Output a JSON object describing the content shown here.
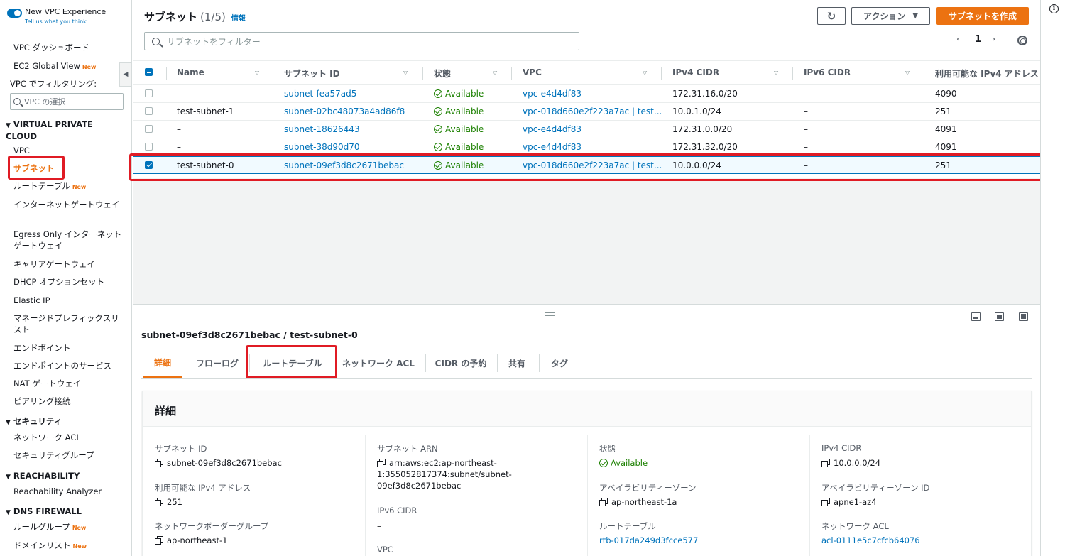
{
  "sidebar": {
    "new_vpc_experience": "New VPC Experience",
    "tell_us": "Tell us what you think",
    "dashboard": "VPC ダッシュボード",
    "ec2_global_view": "EC2 Global View",
    "new_badge": "New",
    "filter_label": "VPC でフィルタリング:",
    "filter_placeholder": "VPC の選択",
    "section_vpc": "VIRTUAL PRIVATE CLOUD",
    "vpc": "VPC",
    "subnets": "サブネット",
    "route_tables": "ルートテーブル",
    "igw": "インターネットゲートウェイ",
    "egress_only": "Egress Only インターネットゲートウェイ",
    "carrier_gw": "キャリアゲートウェイ",
    "dhcp": "DHCP オプションセット",
    "elastic_ip": "Elastic IP",
    "managed_prefix": "マネージドプレフィックスリスト",
    "endpoints": "エンドポイント",
    "endpoint_services": "エンドポイントのサービス",
    "nat_gw": "NAT ゲートウェイ",
    "peering": "ピアリング接続",
    "section_security": "セキュリティ",
    "network_acl": "ネットワーク ACL",
    "security_group": "セキュリティグループ",
    "section_reachability": "REACHABILITY",
    "reachability_analyzer": "Reachability Analyzer",
    "section_dns_firewall": "DNS FIREWALL",
    "rule_groups": "ルールグループ",
    "domain_lists": "ドメインリスト"
  },
  "header": {
    "title": "サブネット",
    "count": "(1/5)",
    "info": "情報",
    "refresh_icon": "refresh-icon",
    "actions": "アクション",
    "create": "サブネットを作成",
    "filter_placeholder": "サブネットをフィルター",
    "page_prev": "‹",
    "page_num": "1",
    "page_next": "›"
  },
  "table": {
    "columns": [
      "Name",
      "サブネット ID",
      "状態",
      "VPC",
      "IPv4 CIDR",
      "IPv6 CIDR",
      "利用可能な IPv4 アドレス"
    ],
    "rows": [
      {
        "name": "–",
        "id": "subnet-fea57ad5",
        "state": "Available",
        "vpc": "vpc-e4d4df83",
        "ipv4": "172.31.16.0/20",
        "ipv6": "–",
        "avail": "4090",
        "selected": false
      },
      {
        "name": "test-subnet-1",
        "id": "subnet-02bc48073a4ad86f8",
        "state": "Available",
        "vpc": "vpc-018d660e2f223a7ac | test...",
        "ipv4": "10.0.1.0/24",
        "ipv6": "–",
        "avail": "251",
        "selected": false
      },
      {
        "name": "–",
        "id": "subnet-18626443",
        "state": "Available",
        "vpc": "vpc-e4d4df83",
        "ipv4": "172.31.0.0/20",
        "ipv6": "–",
        "avail": "4091",
        "selected": false
      },
      {
        "name": "–",
        "id": "subnet-38d90d70",
        "state": "Available",
        "vpc": "vpc-e4d4df83",
        "ipv4": "172.31.32.0/20",
        "ipv6": "–",
        "avail": "4091",
        "selected": false
      },
      {
        "name": "test-subnet-0",
        "id": "subnet-09ef3d8c2671bebac",
        "state": "Available",
        "vpc": "vpc-018d660e2f223a7ac | test...",
        "ipv4": "10.0.0.0/24",
        "ipv6": "–",
        "avail": "251",
        "selected": true
      }
    ]
  },
  "detail": {
    "title": "subnet-09ef3d8c2671bebac / test-subnet-0",
    "tabs": [
      "詳細",
      "フローログ",
      "ルートテーブル",
      "ネットワーク ACL",
      "CIDR の予約",
      "共有",
      "タグ"
    ],
    "card_title": "詳細",
    "subnet_id_label": "サブネット ID",
    "subnet_id": "subnet-09ef3d8c2671bebac",
    "avail_ipv4_label": "利用可能な IPv4 アドレス",
    "avail_ipv4": "251",
    "nbg_label": "ネットワークボーダーグループ",
    "nbg": "ap-northeast-1",
    "arn_label": "サブネット ARN",
    "arn_1": "arn:aws:ec2:ap-northeast-",
    "arn_2": "1:355052817374:subnet/subnet-",
    "arn_3": "09ef3d8c2671bebac",
    "ipv6_label": "IPv6 CIDR",
    "ipv6": "–",
    "vpc_label": "VPC",
    "state_label": "状態",
    "state": "Available",
    "az_label": "アベイラビリティーゾーン",
    "az": "ap-northeast-1a",
    "rtb_label": "ルートテーブル",
    "rtb": "rtb-017da249d3fcce577",
    "ipv4_label": "IPv4 CIDR",
    "ipv4": "10.0.0.0/24",
    "azid_label": "アベイラビリティーゾーン ID",
    "azid": "apne1-az4",
    "nacl_label": "ネットワーク ACL",
    "nacl": "acl-0111e5c7cfcb64076"
  }
}
